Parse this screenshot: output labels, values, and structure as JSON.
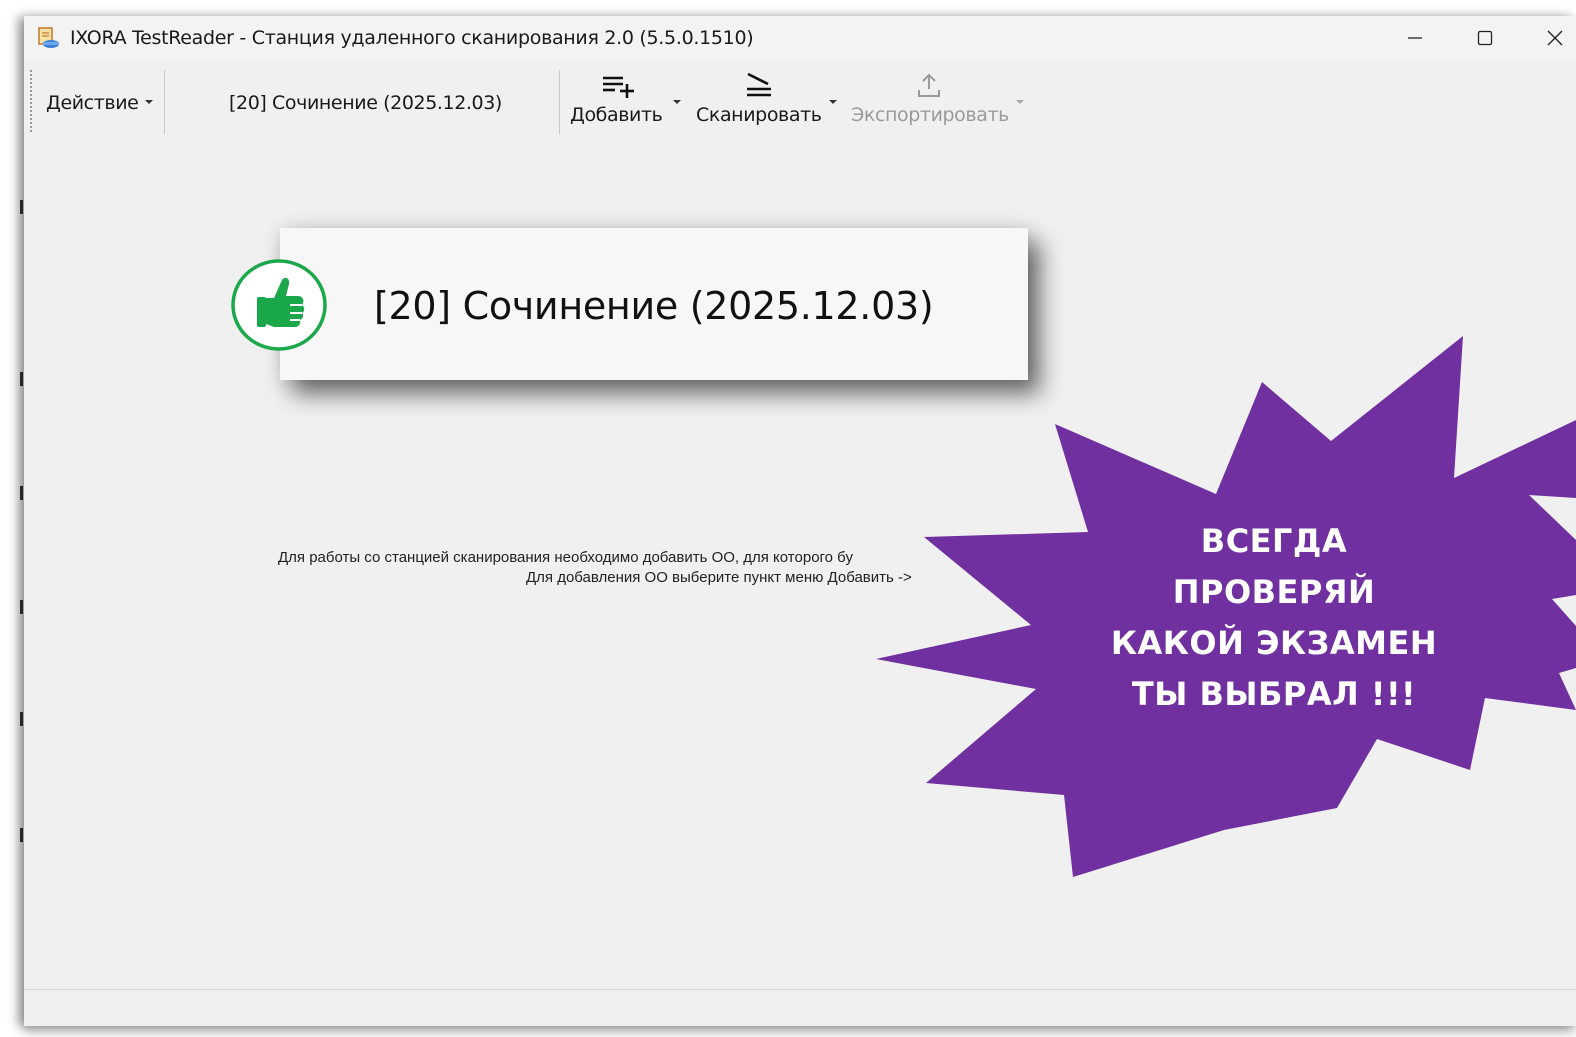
{
  "window": {
    "title": "IXORA TestReader - Станция удаленного сканирования 2.0 (5.5.0.1510)"
  },
  "toolbar": {
    "action_label": "Действие",
    "selected_exam": "[20] Сочинение (2025.12.03)",
    "add_label": "Добавить",
    "scan_label": "Сканировать",
    "export_label": "Экспортировать"
  },
  "callout": {
    "exam_label": "[20] Сочинение (2025.12.03)",
    "icon": "thumbs-up-icon",
    "accent_color": "#1aa84a"
  },
  "main": {
    "info_line1": "Для работы со станцией сканирования необходимо добавить ОО, для которого бу",
    "info_line2": "Для добавления ОО выберите пункт меню Добавить -> "
  },
  "starburst": {
    "color": "#7030a0",
    "lines": [
      "ВСЕГДА",
      "ПРОВЕРЯЙ",
      "КАКОЙ ЭКЗАМЕН",
      "ТЫ ВЫБРАЛ !!!"
    ]
  }
}
